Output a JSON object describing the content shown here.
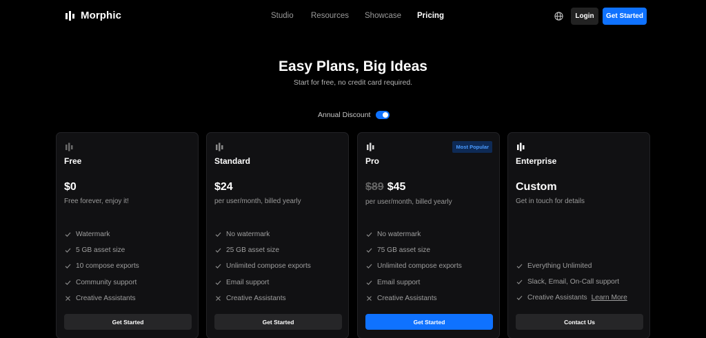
{
  "nav": {
    "brand": "Morphic",
    "links": [
      {
        "label": "Studio",
        "active": false
      },
      {
        "label": "Resources",
        "active": false
      },
      {
        "label": "Showcase",
        "active": false
      },
      {
        "label": "Pricing",
        "active": true
      }
    ],
    "globe_icon": "globe-icon",
    "login_label": "Login",
    "cta_label": "Get Started"
  },
  "hero": {
    "title": "Easy Plans, Big Ideas",
    "subtitle": "Start for free, no credit card required.",
    "discount_label": "Annual Discount",
    "discount_enabled": true
  },
  "colors": {
    "accent": "#0f72ff",
    "background": "#000000",
    "card_bg": "#111113",
    "badge_bg": "#0e2a55",
    "badge_text": "#4a9bff"
  },
  "plans": [
    {
      "name": "Free",
      "price": "$0",
      "old_price": "",
      "subtitle": "Free forever, enjoy it!",
      "badge": "",
      "features": [
        {
          "text": "Watermark",
          "icon": "check"
        },
        {
          "text": "5 GB asset size",
          "icon": "check"
        },
        {
          "text": "10 compose exports",
          "icon": "check"
        },
        {
          "text": "Community support",
          "icon": "check"
        },
        {
          "text": "Creative Assistants",
          "icon": "x"
        }
      ],
      "button": "Get Started"
    },
    {
      "name": "Standard",
      "price": "$24",
      "old_price": "",
      "subtitle": "per user/month, billed yearly",
      "badge": "",
      "features": [
        {
          "text": "No watermark",
          "icon": "check"
        },
        {
          "text": "25 GB asset size",
          "icon": "check"
        },
        {
          "text": "Unlimited compose exports",
          "icon": "check"
        },
        {
          "text": "Email support",
          "icon": "check"
        },
        {
          "text": "Creative Assistants",
          "icon": "x"
        }
      ],
      "button": "Get Started"
    },
    {
      "name": "Pro",
      "price": "$45",
      "old_price": "$89",
      "subtitle": "per user/month, billed yearly",
      "badge": "Most Popular",
      "features": [
        {
          "text": "No watermark",
          "icon": "check"
        },
        {
          "text": "75 GB asset size",
          "icon": "check"
        },
        {
          "text": "Unlimited compose exports",
          "icon": "check"
        },
        {
          "text": "Email support",
          "icon": "check"
        },
        {
          "text": "Creative Assistants",
          "icon": "x"
        }
      ],
      "button": "Get Started"
    },
    {
      "name": "Enterprise",
      "price": "Custom",
      "old_price": "",
      "subtitle": "Get in touch for details",
      "badge": "",
      "features": [
        {
          "text": "Everything Unlimited",
          "icon": "check"
        },
        {
          "text": "Slack, Email, On-Call support",
          "icon": "check"
        },
        {
          "text": "Creative Assistants",
          "icon": "check",
          "link": "Learn More"
        }
      ],
      "button": "Contact Us"
    }
  ]
}
